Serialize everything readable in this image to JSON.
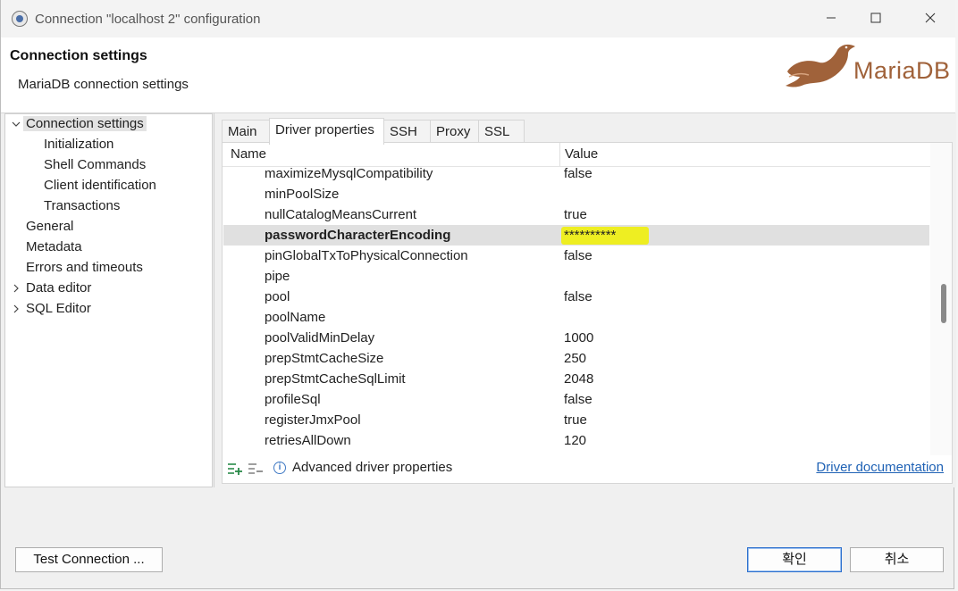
{
  "window": {
    "title": "Connection \"localhost 2\" configuration"
  },
  "header": {
    "title": "Connection settings",
    "subtitle": "MariaDB connection settings",
    "logo_text": "MariaDB"
  },
  "tree": [
    {
      "label": "Connection settings",
      "level": 0,
      "expanded": true,
      "selected": true
    },
    {
      "label": "Initialization",
      "level": 1
    },
    {
      "label": "Shell Commands",
      "level": 1
    },
    {
      "label": "Client identification",
      "level": 1
    },
    {
      "label": "Transactions",
      "level": 1
    },
    {
      "label": "General",
      "level": 0
    },
    {
      "label": "Metadata",
      "level": 0
    },
    {
      "label": "Errors and timeouts",
      "level": 0
    },
    {
      "label": "Data editor",
      "level": 0,
      "collapsed": true
    },
    {
      "label": "SQL Editor",
      "level": 0,
      "collapsed": true
    }
  ],
  "tabs": [
    "Main",
    "Driver properties",
    "SSH",
    "Proxy",
    "SSL"
  ],
  "active_tab": "Driver properties",
  "grid": {
    "col_name": "Name",
    "col_value": "Value",
    "rows": [
      {
        "name": "maximizeMysqlCompatibility",
        "value": "false"
      },
      {
        "name": "minPoolSize",
        "value": ""
      },
      {
        "name": "nullCatalogMeansCurrent",
        "value": "true"
      },
      {
        "name": "passwordCharacterEncoding",
        "value": "**********",
        "selected": true
      },
      {
        "name": "pinGlobalTxToPhysicalConnection",
        "value": "false"
      },
      {
        "name": "pipe",
        "value": ""
      },
      {
        "name": "pool",
        "value": "false"
      },
      {
        "name": "poolName",
        "value": ""
      },
      {
        "name": "poolValidMinDelay",
        "value": "1000"
      },
      {
        "name": "prepStmtCacheSize",
        "value": "250"
      },
      {
        "name": "prepStmtCacheSqlLimit",
        "value": "2048"
      },
      {
        "name": "profileSql",
        "value": "false"
      },
      {
        "name": "registerJmxPool",
        "value": "true"
      },
      {
        "name": "retriesAllDown",
        "value": "120"
      }
    ]
  },
  "bottom": {
    "advanced_label": "Advanced driver properties",
    "doc_link": "Driver documentation"
  },
  "footer": {
    "test_label": "Test Connection ...",
    "ok_label": "확인",
    "cancel_label": "취소"
  },
  "colors": {
    "highlight": "#f0f000",
    "link": "#1f62b5",
    "brand": "#a0623a"
  }
}
